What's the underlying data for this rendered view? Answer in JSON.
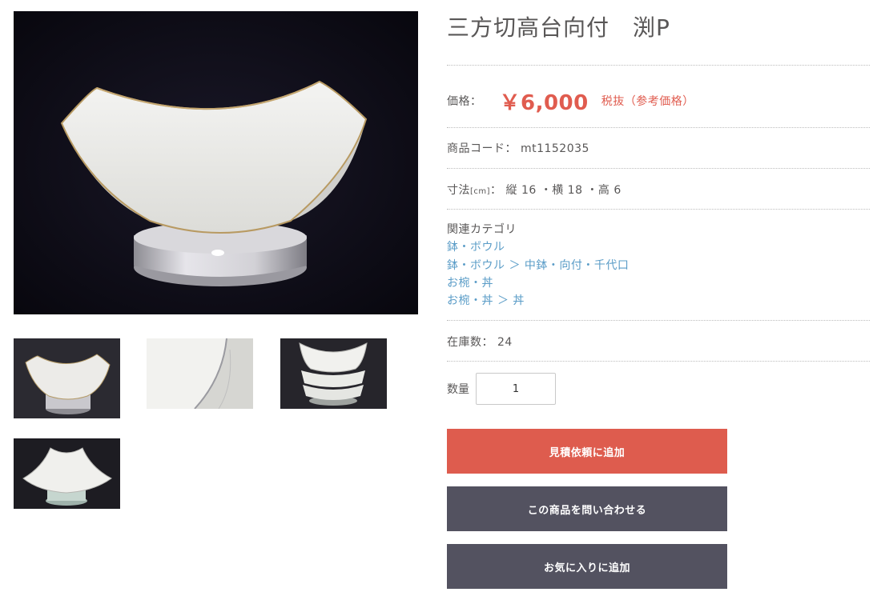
{
  "product": {
    "title": "三方切高台向付　渕P"
  },
  "price": {
    "label": "価格：",
    "value": "￥6,000",
    "note": "税抜（参考価格）"
  },
  "code": {
    "label": "商品コード：",
    "value": "mt1152035"
  },
  "dimensions": {
    "label": "寸法",
    "unit": "[cm]",
    "sep": "：",
    "value": "縦 16 ・横 18 ・高 6"
  },
  "categories": {
    "label": "関連カテゴリ",
    "links": [
      "鉢・ボウル",
      "鉢・ボウル ＞ 中鉢・向付・千代口",
      "お椀・丼",
      "お椀・丼 ＞ 丼"
    ]
  },
  "stock": {
    "label": "在庫数：",
    "value": "24"
  },
  "quantity": {
    "label": "数量",
    "value": "1"
  },
  "buttons": {
    "add_to_quote": "見積依頼に追加",
    "inquire": "この商品を問い合わせる",
    "add_to_favorites": "お気に入りに追加"
  },
  "colors": {
    "price_accent": "#e05c4f",
    "primary_button": "#de5c4e",
    "secondary_button": "#535260",
    "link": "#5a9cc7",
    "text": "#595757"
  }
}
